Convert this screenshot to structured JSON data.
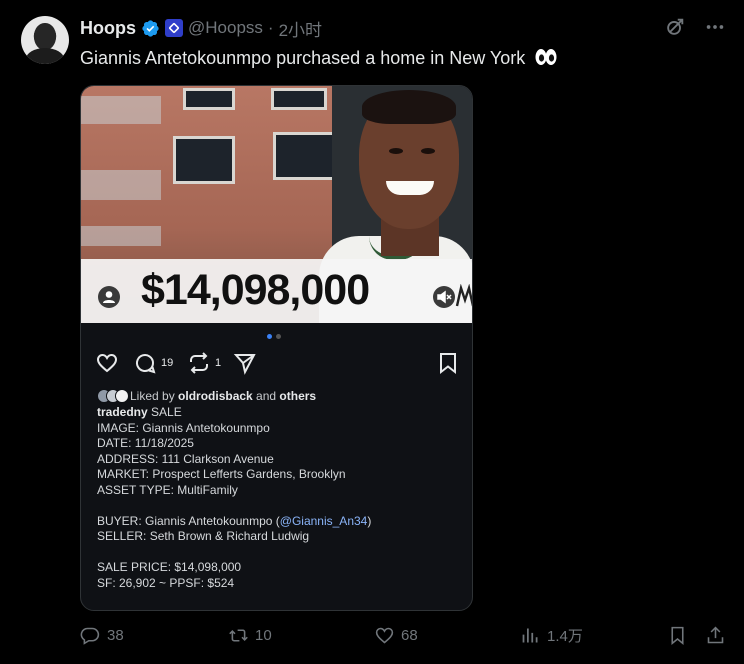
{
  "author": {
    "name": "Hoops",
    "handle": "@Hoopss",
    "separator": "·",
    "time": "2小时"
  },
  "tweet": {
    "text": "Giannis Antetokounmpo purchased a home in New York"
  },
  "media": {
    "price_overlay": "$14,098,000",
    "carousel_total": 2,
    "carousel_active": 1
  },
  "instagram": {
    "comments": "19",
    "reposts": "1",
    "liked_prefix": "Liked by ",
    "liked_user": "oldrodisback",
    "liked_mid": " and ",
    "liked_others": "others",
    "caption_user": "tradedny",
    "caption_first": " SALE",
    "lines": {
      "image": "IMAGE: Giannis Antetokounmpo",
      "date": "DATE: 11/18/2025",
      "address": "ADDRESS: 111 Clarkson Avenue",
      "market": "MARKET: Prospect Lefferts Gardens, Brooklyn",
      "asset": "ASSET TYPE: MultiFamily",
      "buyer_prefix": "BUYER: Giannis Antetokounmpo (",
      "buyer_mention": "@Giannis_An34",
      "buyer_suffix": ")",
      "seller": "SELLER: Seth Brown & Richard Ludwig",
      "sale_price": "SALE PRICE: $14,098,000",
      "sf": "SF: 26,902 ~ PPSF: $524"
    }
  },
  "footer": {
    "replies": "38",
    "retweets": "10",
    "likes": "68",
    "views": "1.4万"
  },
  "colors": {
    "background": "#000000",
    "verified": "#1d9bf0",
    "muted": "#71767b",
    "mention": "#8ab4f8",
    "carousel_active": "#3b82f6"
  },
  "icons": {
    "verified": "verified-badge-icon",
    "affiliate": "affiliate-badge-icon",
    "grok": "grok-icon",
    "more": "more-icon",
    "eyes": "eyes-emoji",
    "ig_like": "heart-outline-icon",
    "ig_comment": "comment-icon",
    "ig_repost": "repost-icon",
    "ig_share": "send-icon",
    "ig_save": "bookmark-icon",
    "reply": "reply-icon",
    "retweet": "retweet-icon",
    "like": "like-icon",
    "views": "views-icon",
    "bookmark": "bookmark-icon",
    "share": "share-icon"
  }
}
